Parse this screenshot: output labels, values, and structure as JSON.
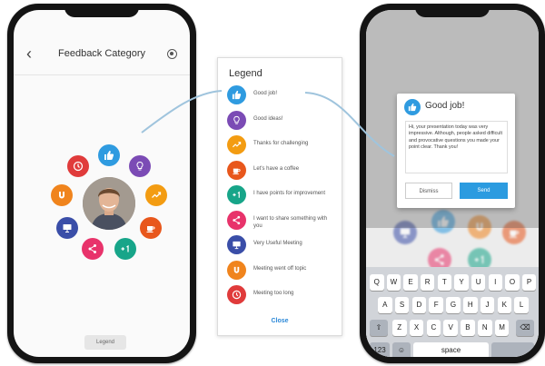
{
  "left_phone": {
    "title": "Feedback Category",
    "back_icon": "‹",
    "legend_button": "Legend"
  },
  "legend": {
    "title": "Legend",
    "items": [
      {
        "label": "Good job!",
        "icon": "thumbs-up-icon",
        "color": "#2f9be0"
      },
      {
        "label": "Good ideas!",
        "icon": "lightbulb-icon",
        "color": "#7b4bb5"
      },
      {
        "label": "Thanks for challenging",
        "icon": "trend-icon",
        "color": "#f39c12"
      },
      {
        "label": "Let's have a coffee",
        "icon": "coffee-icon",
        "color": "#e8571c"
      },
      {
        "label": "I have points for improvement",
        "icon": "plus-one-icon",
        "color": "#17a589"
      },
      {
        "label": "I want to share something with you",
        "icon": "share-icon",
        "color": "#e8336b"
      },
      {
        "label": "Very Useful Meeting",
        "icon": "presentation-icon",
        "color": "#3a4ea8"
      },
      {
        "label": "Meeting went off topic",
        "icon": "magnet-icon",
        "color": "#f0841d"
      },
      {
        "label": "Meeting too long",
        "icon": "clock-icon",
        "color": "#e03b3b"
      }
    ],
    "close": "Close"
  },
  "dialog": {
    "title": "Good job!",
    "message": "Hi, your presentation today was very impressive. Although, people asked difficult and provocative questions you made your point clear. Thank you!",
    "dismiss": "Dismiss",
    "send": "Send"
  },
  "keyboard": {
    "row1": [
      "Q",
      "W",
      "E",
      "R",
      "T",
      "Y",
      "U",
      "I",
      "O",
      "P"
    ],
    "row2": [
      "A",
      "S",
      "D",
      "F",
      "G",
      "H",
      "J",
      "K",
      "L"
    ],
    "row3": [
      "Z",
      "X",
      "C",
      "V",
      "B",
      "N",
      "M"
    ],
    "num_key": "123",
    "space": "space"
  }
}
